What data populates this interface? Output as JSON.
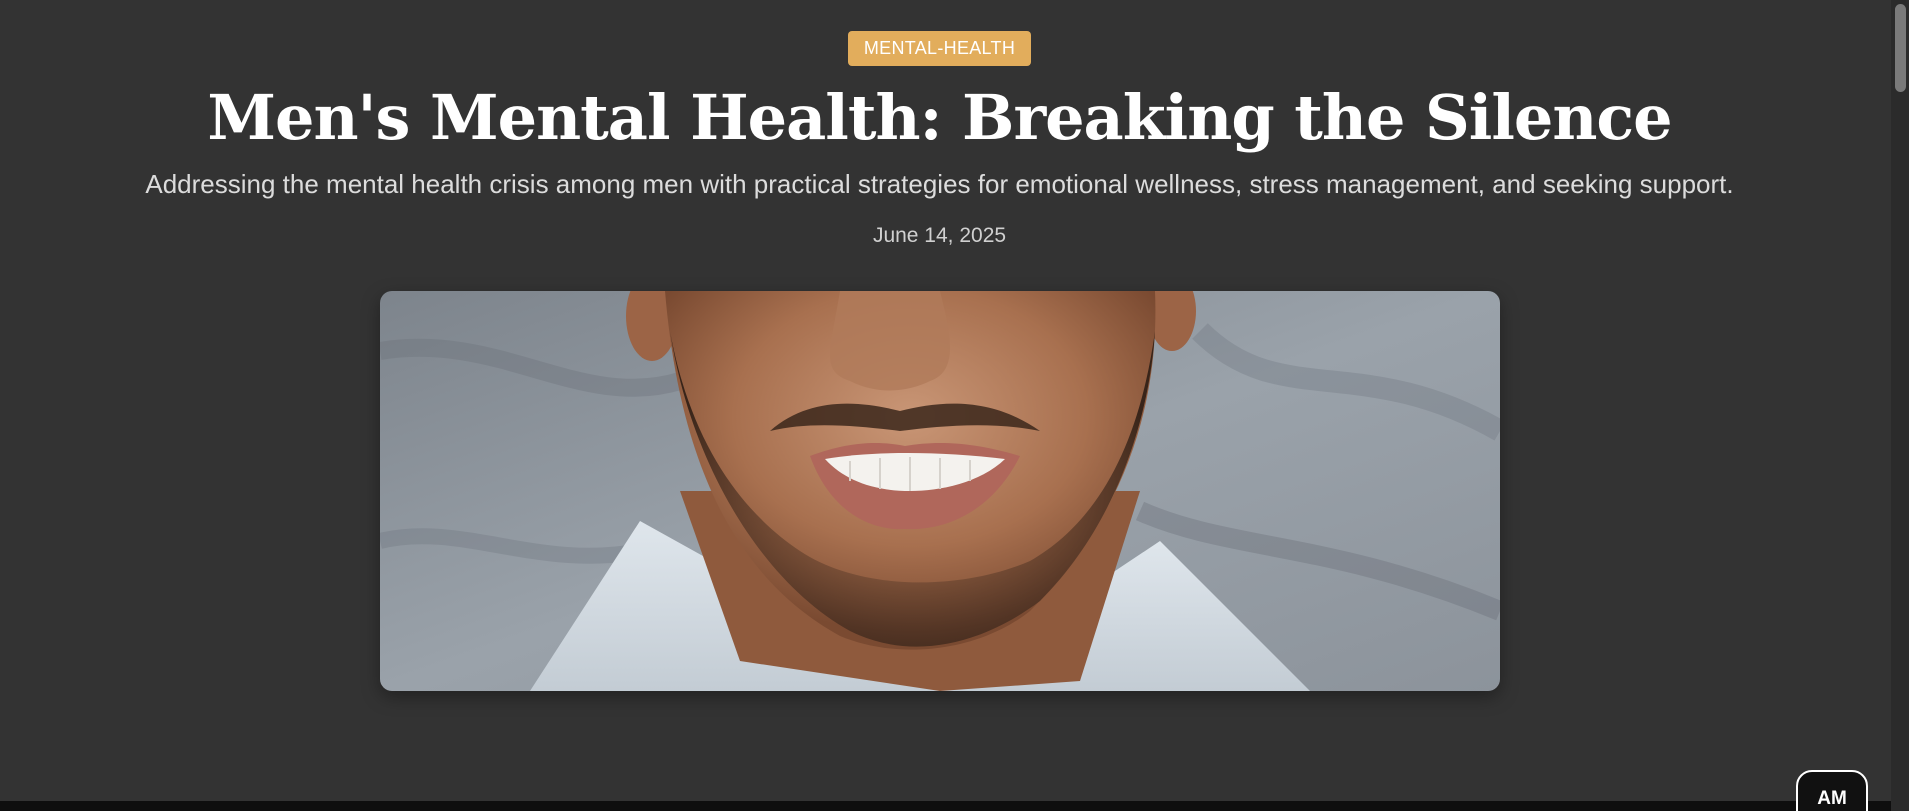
{
  "article": {
    "category": "MENTAL-HEALTH",
    "title": "Men's Mental Health: Breaking the Silence",
    "subtitle": "Addressing the mental health crisis among men with practical strategies for emotional wellness, stress management, and seeking support.",
    "date": "June 14, 2025"
  },
  "user": {
    "initials": "AM"
  },
  "colors": {
    "background": "#333333",
    "badge": "#e2ad5c",
    "title": "#ffffff"
  }
}
